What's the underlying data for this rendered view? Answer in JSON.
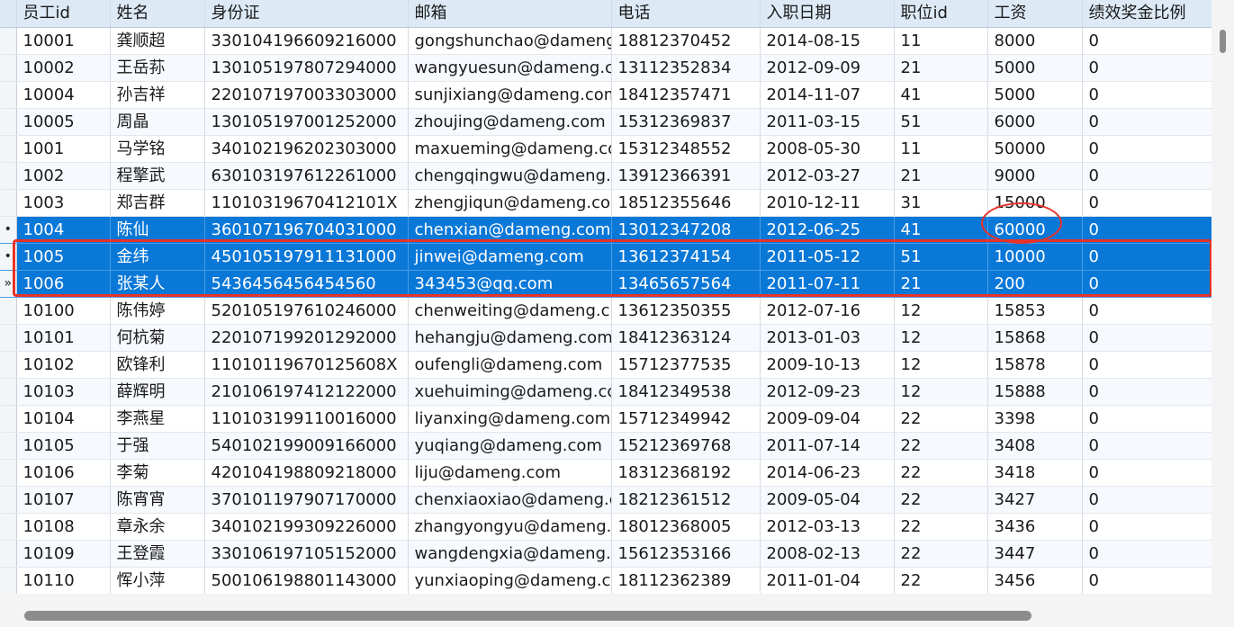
{
  "columns": [
    "员工id",
    "姓名",
    "身份证",
    "邮箱",
    "电话",
    "入职日期",
    "职位id",
    "工资",
    "绩效奖金比例"
  ],
  "rows": [
    {
      "indicator": "",
      "cells": [
        "10001",
        "龚顺超",
        "330104196609216000",
        "gongshunchao@dameng",
        "18812370452",
        "2014-08-15",
        "11",
        "8000",
        "0"
      ]
    },
    {
      "indicator": "",
      "cells": [
        "10002",
        "王岳荪",
        "130105197807294000",
        "wangyuesun@dameng.c",
        "13112352834",
        "2012-09-09",
        "21",
        "5000",
        "0"
      ]
    },
    {
      "indicator": "",
      "cells": [
        "10004",
        "孙吉祥",
        "220107197003303000",
        "sunjixiang@dameng.com",
        "18412357471",
        "2014-11-07",
        "41",
        "5000",
        "0"
      ]
    },
    {
      "indicator": "",
      "cells": [
        "10005",
        "周晶",
        "130105197001252000",
        "zhoujing@dameng.com",
        "15312369837",
        "2011-03-15",
        "51",
        "6000",
        "0"
      ]
    },
    {
      "indicator": "",
      "cells": [
        "1001",
        "马学铭",
        "340102196202303000",
        "maxueming@dameng.co",
        "15312348552",
        "2008-05-30",
        "11",
        "50000",
        "0"
      ]
    },
    {
      "indicator": "",
      "cells": [
        "1002",
        "程擎武",
        "630103197612261000",
        "chengqingwu@dameng.",
        "13912366391",
        "2012-03-27",
        "21",
        "9000",
        "0"
      ]
    },
    {
      "indicator": "",
      "cells": [
        "1003",
        "郑吉群",
        "11010319670412101X",
        "zhengjiqun@dameng.co",
        "18512355646",
        "2010-12-11",
        "31",
        "15000",
        "0"
      ]
    },
    {
      "indicator": "•",
      "selected": true,
      "cells": [
        "1004",
        "陈仙",
        "360107196704031000",
        "chenxian@dameng.com",
        "13012347208",
        "2012-06-25",
        "41",
        "60000",
        "0"
      ]
    },
    {
      "indicator": "•",
      "selected": true,
      "cells": [
        "1005",
        "金纬",
        "450105197911131000",
        "jinwei@dameng.com",
        "13612374154",
        "2011-05-12",
        "51",
        "10000",
        "0"
      ]
    },
    {
      "indicator": "»",
      "selected": true,
      "cells": [
        "1006",
        "张某人",
        "5436456456454560",
        "343453@qq.com",
        "13465657564",
        "2011-07-11",
        "21",
        "200",
        "0"
      ]
    },
    {
      "indicator": "",
      "cells": [
        "10100",
        "陈伟婷",
        "520105197610246000",
        "chenweiting@dameng.c",
        "13612350355",
        "2012-07-16",
        "12",
        "15853",
        "0"
      ]
    },
    {
      "indicator": "",
      "cells": [
        "10101",
        "何杭菊",
        "220107199201292000",
        "hehangju@dameng.com",
        "18412363124",
        "2013-01-03",
        "12",
        "15868",
        "0"
      ]
    },
    {
      "indicator": "",
      "cells": [
        "10102",
        "欧锋利",
        "11010119670125608X",
        "oufengli@dameng.com",
        "15712377535",
        "2009-10-13",
        "12",
        "15878",
        "0"
      ]
    },
    {
      "indicator": "",
      "cells": [
        "10103",
        "薛辉明",
        "210106197412122000",
        "xuehuiming@dameng.co",
        "18412349538",
        "2012-09-23",
        "12",
        "15888",
        "0"
      ]
    },
    {
      "indicator": "",
      "cells": [
        "10104",
        "李燕星",
        "110103199110016000",
        "liyanxing@dameng.com",
        "15712349942",
        "2009-09-04",
        "22",
        "3398",
        "0"
      ]
    },
    {
      "indicator": "",
      "cells": [
        "10105",
        "于强",
        "540102199009166000",
        "yuqiang@dameng.com",
        "15212369768",
        "2011-07-14",
        "22",
        "3408",
        "0"
      ]
    },
    {
      "indicator": "",
      "cells": [
        "10106",
        "李菊",
        "420104198809218000",
        "liju@dameng.com",
        "18312368192",
        "2014-06-23",
        "22",
        "3418",
        "0"
      ]
    },
    {
      "indicator": "",
      "cells": [
        "10107",
        "陈宵宵",
        "370101197907170000",
        "chenxiaoxiao@dameng.c",
        "18212361512",
        "2009-05-04",
        "22",
        "3427",
        "0"
      ]
    },
    {
      "indicator": "",
      "cells": [
        "10108",
        "章永余",
        "340102199309226000",
        "zhangyongyu@dameng.",
        "18012368005",
        "2012-03-13",
        "22",
        "3436",
        "0"
      ]
    },
    {
      "indicator": "",
      "cells": [
        "10109",
        "王登霞",
        "330106197105152000",
        "wangdengxia@dameng.",
        "15612353166",
        "2008-02-13",
        "22",
        "3447",
        "0"
      ]
    },
    {
      "indicator": "",
      "cells": [
        "10110",
        "恽小萍",
        "500106198801143000",
        "yunxiaoping@dameng.c",
        "18112362389",
        "2011-01-04",
        "22",
        "3456",
        "0"
      ]
    }
  ],
  "colors": {
    "header_bg": "#ddeaf6",
    "selection": "#0a78d7",
    "annotation_red": "#e8322a"
  }
}
